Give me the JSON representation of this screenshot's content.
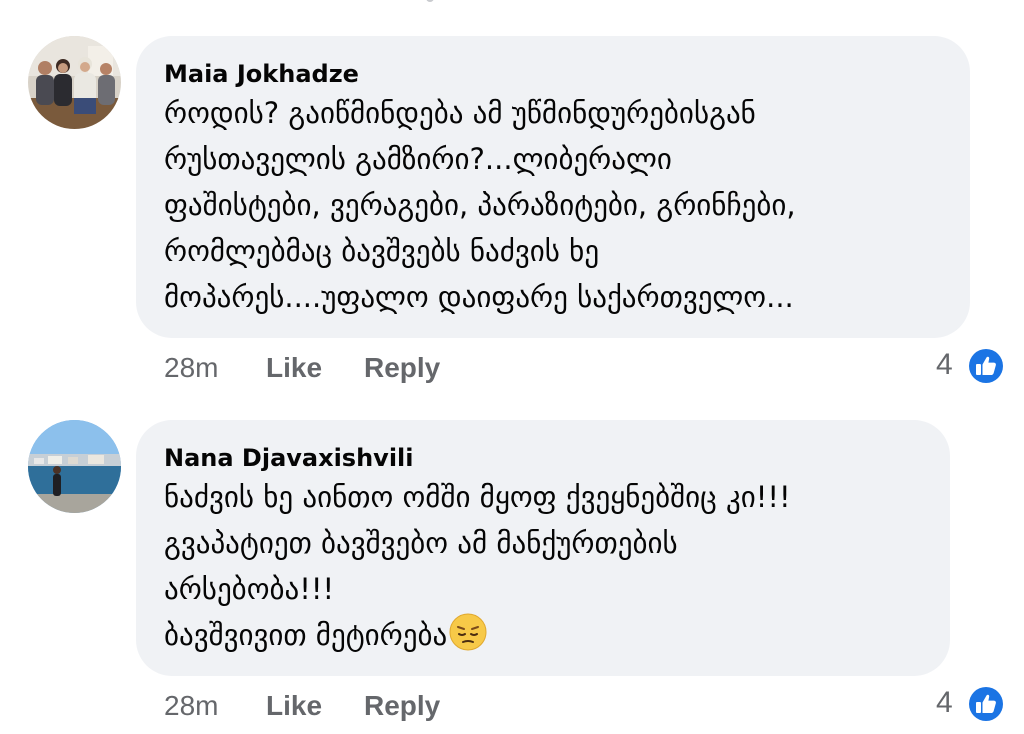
{
  "comments": [
    {
      "author": "Maia Jokhadze",
      "text_lines": [
        "როდის?  გაიწმინდება ამ  უწმინდურებისგან",
        "რუსთაველის  გამზირი?...ლიბერალი",
        "ფაშისტები, ვერაგები, პარაზიტები,  გრინჩები,",
        "რომლებმაც  ბავშვებს  ნაძვის ხე",
        "მოპარეს....უფალო  დაიფარე საქართველო..."
      ],
      "time": "28m",
      "like_label": "Like",
      "reply_label": "Reply",
      "reaction_count": "4",
      "reaction_icon": "like-thumb-icon"
    },
    {
      "author": "Nana Djavaxishvili",
      "text_lines": [
        "ნაძვის ხე აინთო ომში მყოფ ქვეყნებშიც კი!!!",
        "გვაპატიეთ ბავშვებო ამ მანქურთების",
        "არსებობა!!!",
        "ბავშვივით მეტირება"
      ],
      "trailing_emoji": "pensive-face-emoji",
      "time": "28m",
      "like_label": "Like",
      "reply_label": "Reply",
      "reaction_count": "4",
      "reaction_icon": "like-thumb-icon"
    }
  ],
  "colors": {
    "bubble": "#f0f2f5",
    "text": "#050505",
    "secondary": "#65676b",
    "like_blue": "#1b74e4"
  }
}
